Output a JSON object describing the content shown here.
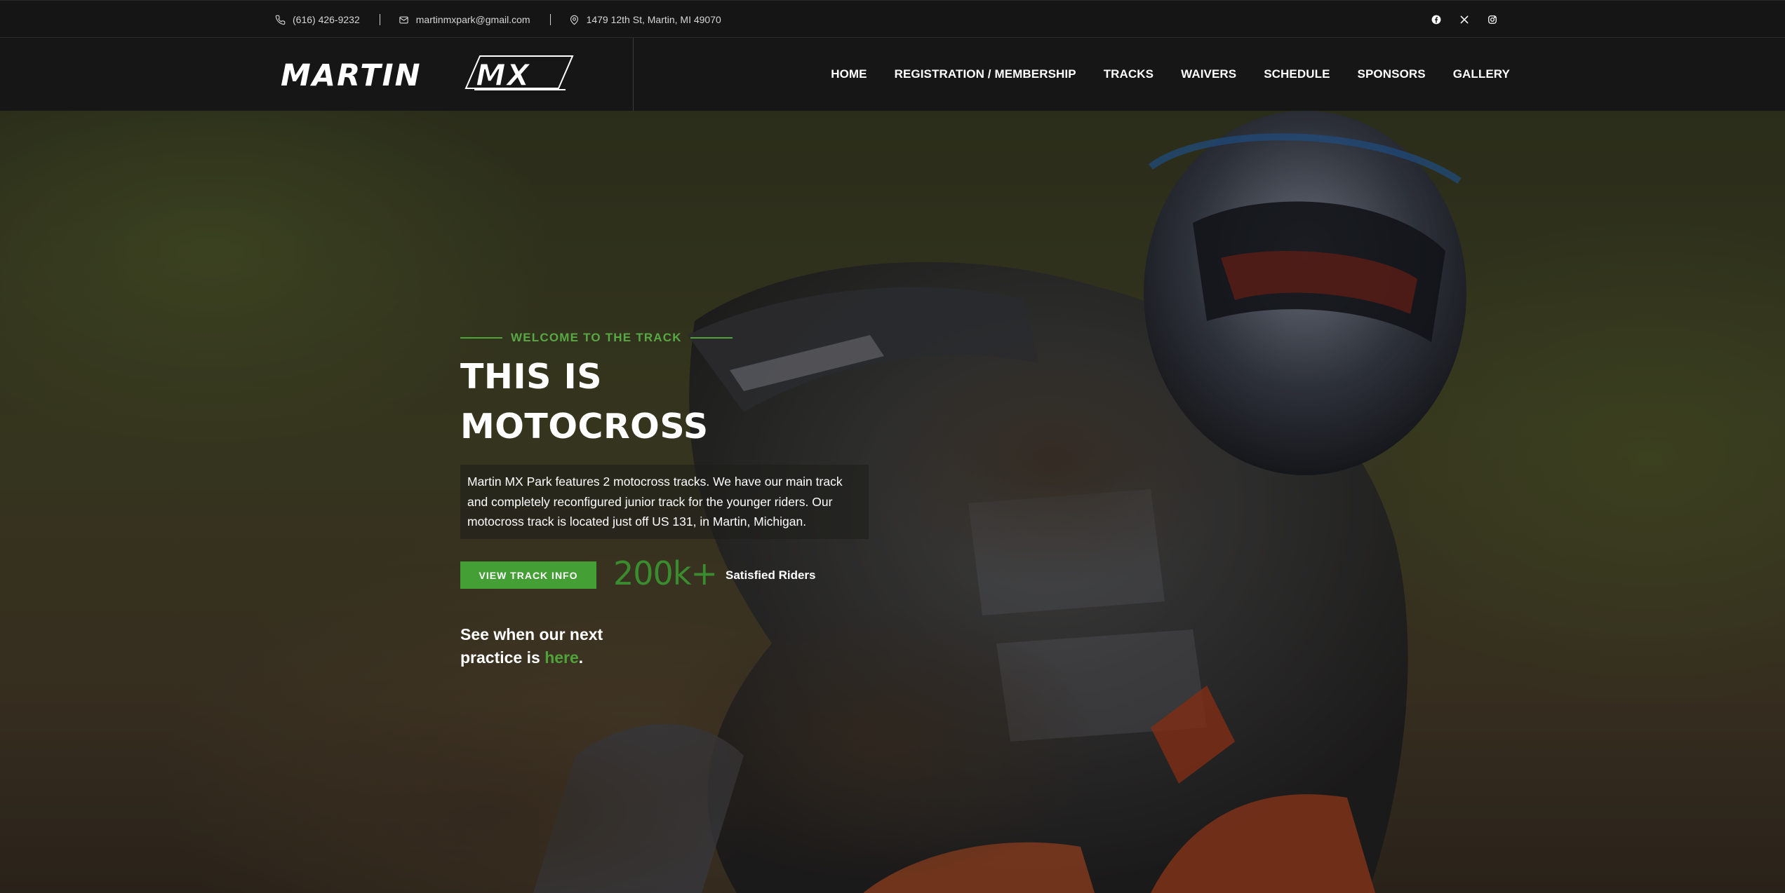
{
  "topbar": {
    "phone": "(616) 426-9232",
    "email": "martinmxpark@gmail.com",
    "address": "1479 12th St, Martin, MI 49070",
    "icons": [
      "phone-icon",
      "envelope-icon",
      "map-pin-icon"
    ],
    "social": [
      "facebook-icon",
      "x-twitter-icon",
      "instagram-icon"
    ]
  },
  "header": {
    "logo_text": "MARTIN MX",
    "nav": [
      "HOME",
      "REGISTRATION / MEMBERSHIP",
      "TRACKS",
      "WAIVERS",
      "SCHEDULE",
      "SPONSORS",
      "GALLERY"
    ]
  },
  "hero": {
    "eyebrow": "WELCOME TO THE TRACK",
    "headline": "THIS IS MOTOCROSS",
    "description": "Martin MX Park features 2 motocross tracks. We have our main track and completely reconfigured junior track for the younger riders. Our motocross track is located just off US 131, in Martin, Michigan.",
    "cta_label": "VIEW TRACK INFO",
    "stat_number": "200k+",
    "stat_label": "Satisfied Riders",
    "practice_prefix": "See when our next practice is ",
    "practice_link": "here",
    "practice_suffix": "."
  },
  "colors": {
    "accent": "#4ea43a",
    "topbar_bg": "#151515",
    "header_bg": "#161616"
  }
}
